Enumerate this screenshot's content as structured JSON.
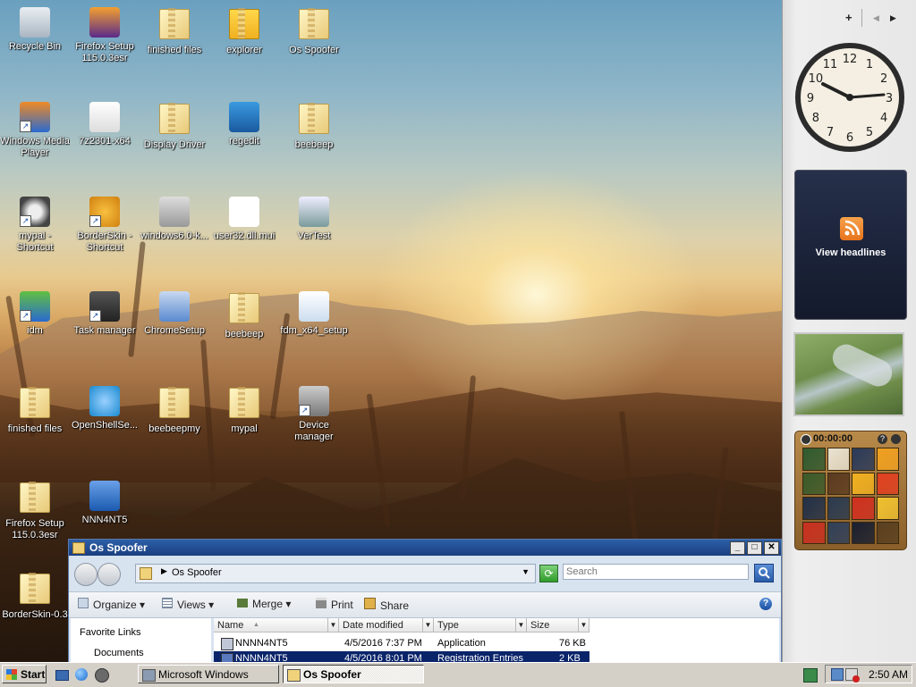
{
  "desktop_icons": [
    {
      "label": "Recycle Bin",
      "icon": "recycle-bin-icon",
      "shortcut": false
    },
    {
      "label": "Firefox Setup 115.0.3esr",
      "icon": "installer-box-icon",
      "shortcut": false
    },
    {
      "label": "finished files",
      "icon": "folder-icon",
      "shortcut": false
    },
    {
      "label": "explorer",
      "icon": "folder-open-icon",
      "shortcut": false
    },
    {
      "label": "Os Spoofer",
      "icon": "folder-icon",
      "shortcut": false
    },
    {
      "label": "Windows Media Player",
      "icon": "media-player-icon",
      "shortcut": true
    },
    {
      "label": "7z2301-x64",
      "icon": "7zip-icon",
      "shortcut": false
    },
    {
      "label": "Display Driver",
      "icon": "folder-icon",
      "shortcut": false
    },
    {
      "label": "regedit",
      "icon": "registry-cubes-icon",
      "shortcut": false
    },
    {
      "label": "beebeep",
      "icon": "zip-folder-icon",
      "shortcut": false
    },
    {
      "label": "mypal - Shortcut",
      "icon": "raccoon-icon",
      "shortcut": true
    },
    {
      "label": "BorderSkin - Shortcut",
      "icon": "borderskin-icon",
      "shortcut": true
    },
    {
      "label": "windows6.0-k...",
      "icon": "installer-icon",
      "shortcut": false
    },
    {
      "label": "user32.dll.mui",
      "icon": "blank-file-icon",
      "shortcut": false
    },
    {
      "label": "VerTest",
      "icon": "window-app-icon",
      "shortcut": false
    },
    {
      "label": "idm",
      "icon": "idm-icon",
      "shortcut": true
    },
    {
      "label": "Task manager",
      "icon": "task-manager-icon",
      "shortcut": true
    },
    {
      "label": "ChromeSetup",
      "icon": "setup-disc-icon",
      "shortcut": false
    },
    {
      "label": "beebeep",
      "icon": "zip-folder-icon",
      "shortcut": false
    },
    {
      "label": "fdm_x64_setup",
      "icon": "download-arrow-icon",
      "shortcut": false
    },
    {
      "label": "finished files",
      "icon": "zip-folder-icon",
      "shortcut": false
    },
    {
      "label": "OpenShellSe...",
      "icon": "shell-icon",
      "shortcut": false
    },
    {
      "label": "beebeepmy",
      "icon": "zip-folder-icon",
      "shortcut": false
    },
    {
      "label": "mypal",
      "icon": "zip-folder-icon",
      "shortcut": false
    },
    {
      "label": "Device manager",
      "icon": "device-manager-icon",
      "shortcut": true
    },
    {
      "label": "Firefox Setup 115.0.3esr",
      "icon": "folder-icon",
      "shortcut": false
    },
    {
      "label": "NNN4NT5",
      "icon": "cabinet-icon",
      "shortcut": false
    },
    {
      "label": "BorderSkin-0.3",
      "icon": "zip-folder-icon",
      "shortcut": false
    }
  ],
  "sidebar": {
    "add_symbol": "+",
    "prev_symbol": "◀",
    "next_symbol": "▶",
    "clock_numbers": [
      "12",
      "1",
      "2",
      "3",
      "4",
      "5",
      "6",
      "7",
      "8",
      "9",
      "10",
      "11"
    ],
    "feed_label": "View headlines",
    "puzzle_timer": "00:00:00"
  },
  "explorer": {
    "title": "Os Spoofer",
    "address": "Os Spoofer",
    "search_placeholder": "Search",
    "commands": {
      "organize": "Organize",
      "views": "Views",
      "merge": "Merge",
      "print": "Print",
      "share": "Share"
    },
    "nav_links": [
      "Favorite Links",
      "Documents"
    ],
    "columns": [
      "Name",
      "Date modified",
      "Type",
      "Size"
    ],
    "files": [
      {
        "name": "NNNN4NT5",
        "date": "4/5/2016 7:37 PM",
        "type": "Application",
        "size": "76 KB",
        "selected": false
      },
      {
        "name": "NNNN4NT5",
        "date": "4/5/2016 8:01 PM",
        "type": "Registration Entries",
        "size": "2 KB",
        "selected": true
      }
    ]
  },
  "taskbar": {
    "start_label": "Start",
    "tasks": [
      {
        "label": "Microsoft Windows",
        "active": false
      },
      {
        "label": "Os Spoofer",
        "active": true
      }
    ],
    "clock": "2:50 AM"
  },
  "colors": {
    "title_bar": "#1a3f80",
    "selection": "#0a246a",
    "taskbar": "#d4d0c8",
    "accent_orange": "#f08a24"
  }
}
